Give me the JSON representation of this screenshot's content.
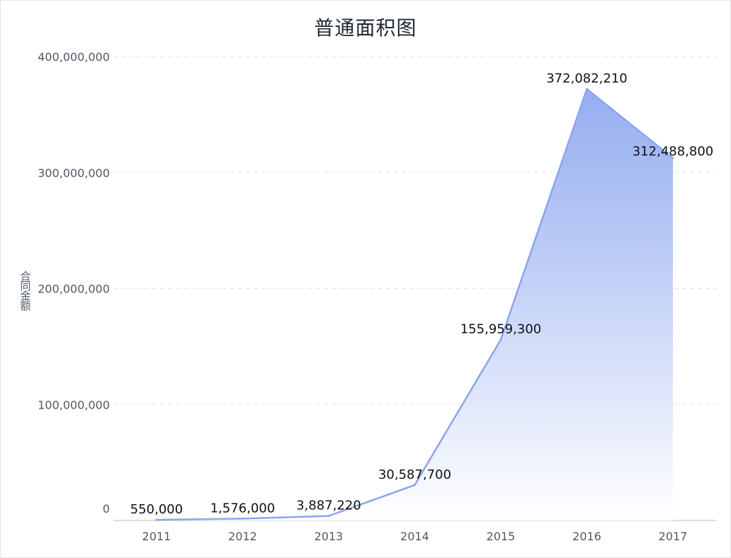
{
  "chart_data": {
    "type": "area",
    "title": "普通面积图",
    "xlabel": "",
    "ylabel": "合同金额",
    "categories": [
      "2011",
      "2012",
      "2013",
      "2014",
      "2015",
      "2016",
      "2017"
    ],
    "series": [
      {
        "values": [
          550000,
          1576000,
          3887220,
          30587700,
          155959300,
          372082210,
          312488800
        ],
        "labels": [
          "550,000",
          "1,576,000",
          "3,887,220",
          "30,587,700",
          "155,959,300",
          "372,082,210",
          "312,488,800"
        ]
      }
    ],
    "ylim": [
      0,
      400000000
    ],
    "yticks": [
      0,
      100000000,
      200000000,
      300000000,
      400000000
    ],
    "ytick_labels": [
      "0",
      "100,000,000",
      "200,000,000",
      "300,000,000",
      "400,000,000"
    ],
    "grid": true,
    "colors": {
      "line": "#8aa5ee",
      "fill_top": "#90a9f0",
      "fill_bottom": "#ffffff",
      "grid": "#e3e6ec",
      "axis": "#cfd3da"
    }
  }
}
